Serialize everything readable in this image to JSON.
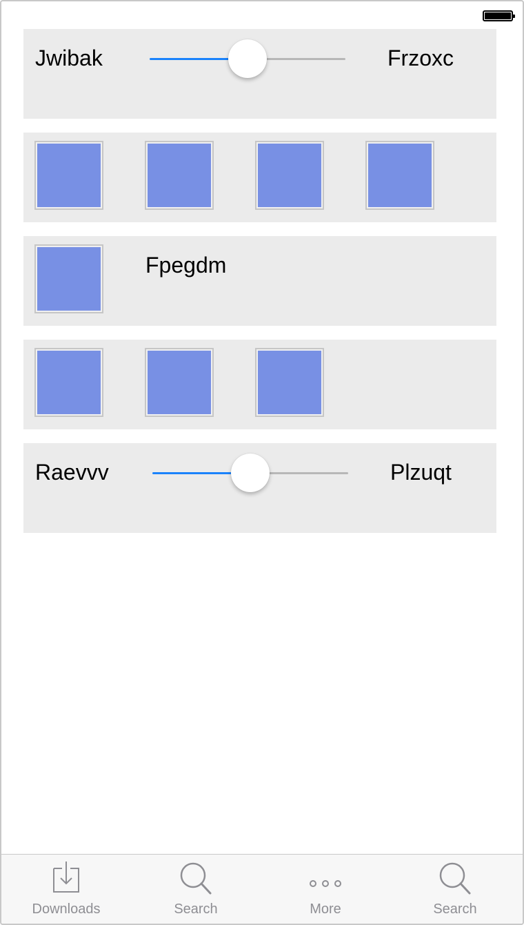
{
  "status_bar": {
    "battery": "full"
  },
  "rows": {
    "slider_top": {
      "min_label": "Jwibak",
      "max_label": "Frzoxc",
      "value": 0.5
    },
    "image_row_1": {
      "count": 4
    },
    "image_text_row": {
      "label": "Fpegdm"
    },
    "image_row_2": {
      "count": 3
    },
    "slider_bottom": {
      "min_label": "Raevvv",
      "max_label": "Plzuqt",
      "value": 0.5
    }
  },
  "colors": {
    "accent": "#1a82fb",
    "image_fill": "#7890e4",
    "panel_bg": "#ebebeb",
    "tab_inactive": "#8e8e93"
  },
  "tabbar": {
    "items": [
      {
        "label": "Downloads",
        "icon": "downloads-icon"
      },
      {
        "label": "Search",
        "icon": "search-icon"
      },
      {
        "label": "More",
        "icon": "more-icon"
      },
      {
        "label": "Search",
        "icon": "search-icon"
      }
    ]
  }
}
